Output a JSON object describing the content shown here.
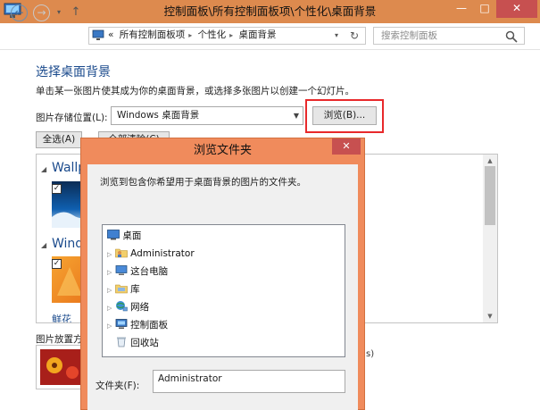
{
  "window": {
    "title": "控制面板\\所有控制面板项\\个性化\\桌面背景",
    "controls": {
      "minimize": "—",
      "maximize": "□",
      "close": "✕"
    }
  },
  "nav": {
    "back": "←",
    "forward": "→",
    "recent": "▾",
    "up": "↑",
    "breadcrumb_prefix": "«",
    "breadcrumbs": [
      "所有控制面板项",
      "个性化",
      "桌面背景"
    ],
    "refresh": "↻",
    "search_placeholder": "搜索控制面板"
  },
  "main": {
    "heading": "选择桌面背景",
    "description": "单击某一张图片使其成为你的桌面背景，或选择多张图片以创建一个幻灯片。",
    "location_label": "图片存储位置(L):",
    "location_value": "Windows 桌面背景",
    "browse_label": "浏览(B)...",
    "select_all_label": "全选(A)",
    "clear_all_label": "全部清除(C)",
    "groups": [
      "Wallp",
      "Windo",
      "鲜花"
    ],
    "position_label": "图片放置方",
    "peek_text": "s)"
  },
  "dialog": {
    "title": "浏览文件夹",
    "close": "✕",
    "description": "浏览到包含你希望用于桌面背景的图片的文件夹。",
    "tree": [
      {
        "label": "桌面",
        "icon": "desktop-icon",
        "expandable": false
      },
      {
        "label": "Administrator",
        "icon": "user-folder-icon",
        "expandable": true
      },
      {
        "label": "这台电脑",
        "icon": "computer-icon",
        "expandable": true
      },
      {
        "label": "库",
        "icon": "library-icon",
        "expandable": true
      },
      {
        "label": "网络",
        "icon": "network-icon",
        "expandable": true
      },
      {
        "label": "控制面板",
        "icon": "control-panel-icon",
        "expandable": true
      },
      {
        "label": "回收站",
        "icon": "recycle-bin-icon",
        "expandable": false
      }
    ],
    "folder_label": "文件夹(F):",
    "folder_value": "Administrator"
  },
  "colors": {
    "title_bar": "#dd8a4e",
    "dialog_frame": "#f08b5c",
    "close_button": "#c75050",
    "highlight": "#e8292b",
    "heading": "#1a4a8c"
  }
}
